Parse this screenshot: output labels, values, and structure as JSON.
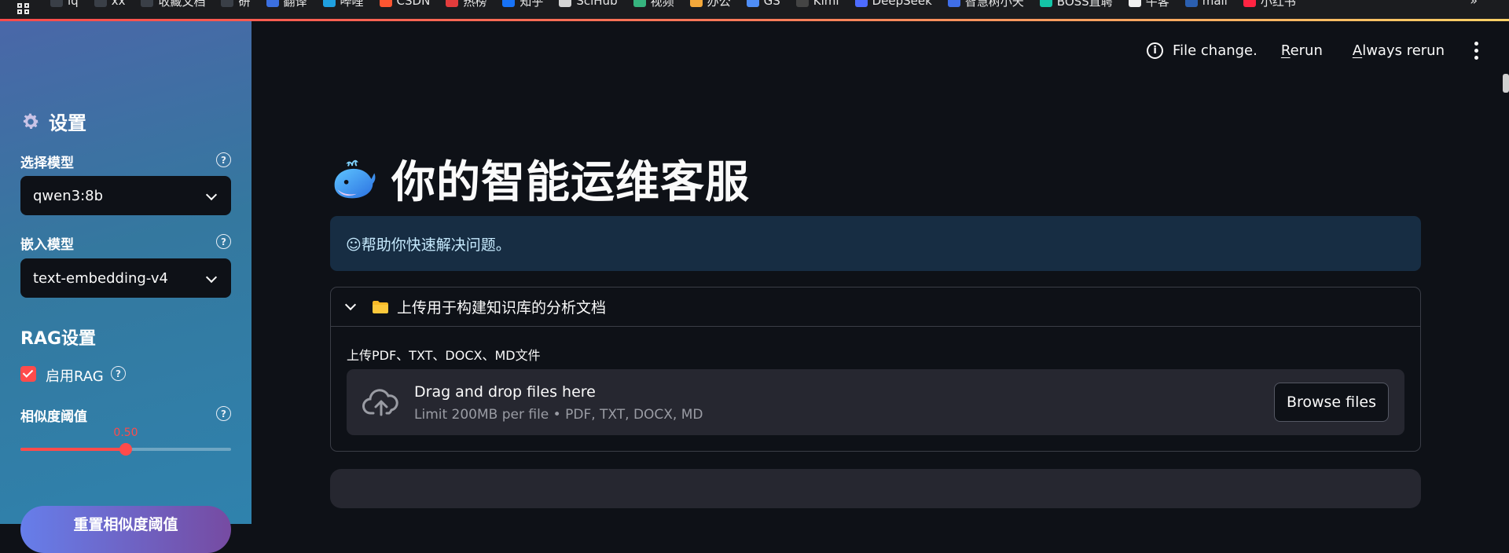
{
  "browser": {
    "bookmarks": [
      {
        "label": "lq",
        "color": "#3a3f47"
      },
      {
        "label": "xx",
        "color": "#3a3f47"
      },
      {
        "label": "收藏文档",
        "color": "#3a3f47"
      },
      {
        "label": "研",
        "color": "#3a3f47"
      },
      {
        "label": "翻译",
        "color": "#3b6fe0"
      },
      {
        "label": "哔哩",
        "color": "#1fa0e0"
      },
      {
        "label": "CSDN",
        "color": "#fc5531"
      },
      {
        "label": "热榜",
        "color": "#e23c3c"
      },
      {
        "label": "知乎",
        "color": "#1772f6"
      },
      {
        "label": "SciHub",
        "color": "#d4d4d4"
      },
      {
        "label": "视频",
        "color": "#36b37e"
      },
      {
        "label": "办公",
        "color": "#f3a83b"
      },
      {
        "label": "GS",
        "color": "#4f8ef7"
      },
      {
        "label": "Kimi",
        "color": "#444444"
      },
      {
        "label": "DeepSeek",
        "color": "#4d6bfe"
      },
      {
        "label": "智慧树小天",
        "color": "#3f6ee8"
      },
      {
        "label": "BOSS直聘",
        "color": "#14c4a6"
      },
      {
        "label": "牛客",
        "color": "#f0f0f0"
      },
      {
        "label": "mail",
        "color": "#2b5fb0"
      },
      {
        "label": "小红书",
        "color": "#ff2442"
      }
    ],
    "more_label": "»"
  },
  "sidebar": {
    "heading": "设置",
    "model_label": "选择模型",
    "model_value": "qwen3:8b",
    "embed_label": "嵌入模型",
    "embed_value": "text-embedding-v4",
    "rag_heading": "RAG设置",
    "rag_enabled_label": "启用RAG",
    "rag_enabled": true,
    "threshold_label": "相似度阈值",
    "threshold_value": "0.50",
    "threshold_fraction": 0.5,
    "reset_button": "重置相似度阈值",
    "help_glyph": "?"
  },
  "topbar": {
    "status_text": "File change.",
    "rerun_label": "Rerun",
    "rerun_accel": "R",
    "rerun_rest": "erun",
    "always_label": "Always rerun",
    "always_accel": "A",
    "always_rest": "lways rerun",
    "info_glyph": "i"
  },
  "main": {
    "title": "你的智能运维客服",
    "info_text": "☺帮助你快速解决问题。",
    "expander_title": "上传用于构建知识库的分析文档",
    "upload_label": "上传PDF、TXT、DOCX、MD文件",
    "dropzone_title": "Drag and drop files here",
    "dropzone_subtitle": "Limit 200MB per file • PDF, TXT, DOCX, MD",
    "browse_button": "Browse files"
  },
  "colors": {
    "accent": "#ff4b4b",
    "background": "#0e1117",
    "info_bg": "#172d43",
    "button_gradient_start": "#667eea",
    "button_gradient_end": "#764ba2"
  }
}
